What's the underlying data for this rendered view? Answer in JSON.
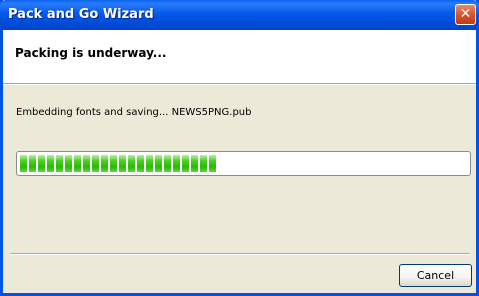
{
  "window": {
    "title": "Pack and Go Wizard"
  },
  "header": {
    "heading": "Packing is underway..."
  },
  "status": {
    "text": "Embedding fonts and saving... NEWS5PNG.pub"
  },
  "progress": {
    "fraction": 0.44
  },
  "buttons": {
    "cancel_label": "Cancel"
  },
  "icons": {
    "close": "close-icon"
  },
  "colors": {
    "titlebar": "#0054E3",
    "progress_fill": "#2BB807",
    "dialog_bg": "#ECE9D8"
  }
}
